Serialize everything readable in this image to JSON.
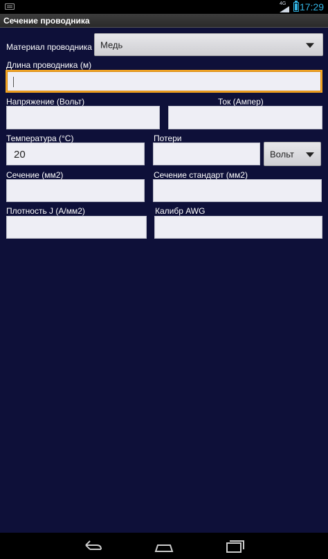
{
  "status_bar": {
    "network": "4G",
    "time": "17:29",
    "battery_level": 0.85
  },
  "title": "Сечение проводника",
  "material": {
    "label": "Материал проводника",
    "value": "Медь"
  },
  "length": {
    "label": "Длина проводника (м)",
    "value": ""
  },
  "voltage": {
    "label": "Напряжение (Вольт)",
    "value": ""
  },
  "current": {
    "label": "Ток (Ампер)",
    "value": ""
  },
  "temperature": {
    "label": "Температура (°C)",
    "value": "20"
  },
  "losses": {
    "label": "Потери",
    "value": "",
    "unit": "Вольт"
  },
  "section": {
    "label": "Сечение (мм2)",
    "value": ""
  },
  "standard_section": {
    "label": "Сечение стандарт (мм2)",
    "value": ""
  },
  "density": {
    "label": "Плотность J (А/мм2)",
    "value": ""
  },
  "awg": {
    "label": "Калибр  AWG",
    "value": ""
  },
  "icons": {
    "keyboard": "keyboard-icon",
    "signal": "signal-icon",
    "battery": "battery-icon",
    "dropdown": "triangle-down-icon",
    "back": "back-icon",
    "home": "home-icon",
    "recents": "recents-icon"
  },
  "colors": {
    "background": "#0e1039",
    "accent": "#33b5e5",
    "focus": "#f5a623"
  }
}
